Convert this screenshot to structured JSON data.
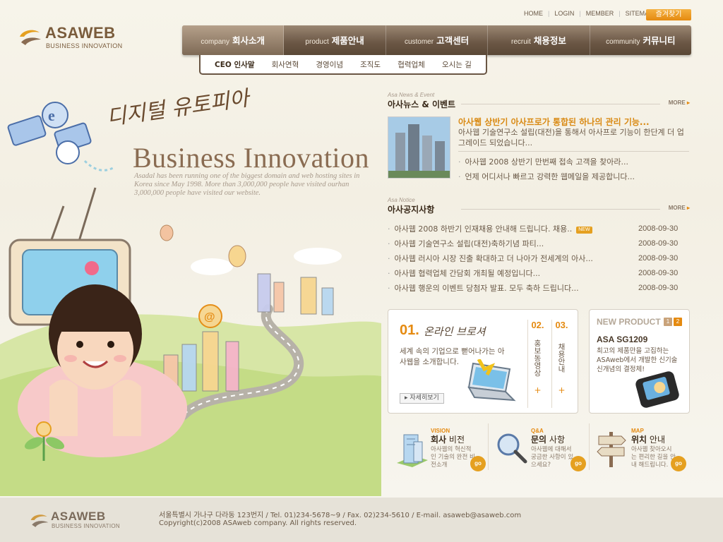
{
  "brand": {
    "name": "ASAWEB",
    "tagline": "BUSINESS INNOVATION"
  },
  "util_links": [
    "HOME",
    "LOGIN",
    "MEMBER",
    "SITEMAP"
  ],
  "favorite_label": "즐겨찾기",
  "gnb": [
    {
      "en": "company",
      "ko": "회사소개"
    },
    {
      "en": "product",
      "ko": "제품안내"
    },
    {
      "en": "customer",
      "ko": "고객센터"
    },
    {
      "en": "recruit",
      "ko": "채용정보"
    },
    {
      "en": "community",
      "ko": "커뮤니티"
    }
  ],
  "sub_nav": [
    "CEO 인사말",
    "회사연혁",
    "경영이념",
    "조직도",
    "협력업체",
    "오시는 길"
  ],
  "hero": {
    "script": "디지털 유토피아",
    "title": "Business Innovation",
    "desc": "Asadal has been running one of the biggest domain and web hosting sites in Korea since May 1998. More than 3,000,000 people have visited ourhan 3,000,000 people have visited our website."
  },
  "news": {
    "en": "Asa News & Event",
    "ko": "아사뉴스 & 이벤트",
    "more": "MORE",
    "headline": "아사웹 상반기 아사프로가 통합된 하나의 관리 기능...",
    "summary": "아사웹 기술연구소 설립(대전)을 통해서 아사프로 기능이 한단계 더 업그레이드 되었습니다...",
    "items": [
      "아사웹 2008 상반기 만번째 접속 고객을 찾아라...",
      "언제 어디서나 빠르고 강력한 웹메일을 제공합니다..."
    ]
  },
  "notice": {
    "en": "Asa Notice",
    "ko": "아사공지사항",
    "more": "MORE",
    "new_badge": "NEW",
    "items": [
      {
        "title": "아사웹 2008 하반기 인재채용 안내해 드립니다. 채용..",
        "date": "2008-09-30"
      },
      {
        "title": "아사웹 기술연구소 설립(대전)축하기념 파티...",
        "date": "2008-09-30"
      },
      {
        "title": "아사웹 러시아 시장 진출 확대하고 더 나아가 전세계의 아사...",
        "date": "2008-09-30"
      },
      {
        "title": "아사웹 협력업체 간담회 개최될 예정입니다...",
        "date": "2008-09-30"
      },
      {
        "title": "아사웹 행운의 이벤트 당첨자 발표. 모두 축하 드립니다...",
        "date": "2008-09-30"
      }
    ]
  },
  "online": {
    "num": "01.",
    "title": "온라인 브로셔",
    "text": "세계 속의 기업으로 뻗어나가는 아사웹을 소개합니다.",
    "button": "자세히보기",
    "side": [
      {
        "num": "02.",
        "label": "홍보동영상"
      },
      {
        "num": "03.",
        "label": "채용안내"
      }
    ]
  },
  "new_product": {
    "label": "NEW PRODUCT",
    "pages": [
      "1",
      "2"
    ],
    "name": "ASA SG1209",
    "desc": "최고의 제품만을 고집하는 ASAweb에서 개발한 신기술 신개념의 결정체!"
  },
  "quick": [
    {
      "en": "VISION",
      "ko_bold": "회사",
      "ko": " 비전",
      "desc": "아사웹의 혁신적인 기술의 완전 비전소개"
    },
    {
      "en": "Q&A",
      "ko_bold": "문의",
      "ko": " 사항",
      "desc": "아사웹에 대해서 궁금한 사항이 있으세요?"
    },
    {
      "en": "MAP",
      "ko_bold": "위치",
      "ko": " 안내",
      "desc": "아사웹 찾아오시는 편리한 길을 안내 해드립니다."
    }
  ],
  "go_label": "go",
  "footer": {
    "address": "서울특별시 가나구 다라동 123번지  /  Tel. 01)234-5678~9  /  Fax. 02)234-5610  /  E-mail. asaweb@asaweb.com",
    "copyright": "Copyright(c)2008 ASAweb company. All rights reserved."
  },
  "colors": {
    "accent": "#e58a10",
    "brown": "#6a5644",
    "bg": "#f6f3ea"
  }
}
